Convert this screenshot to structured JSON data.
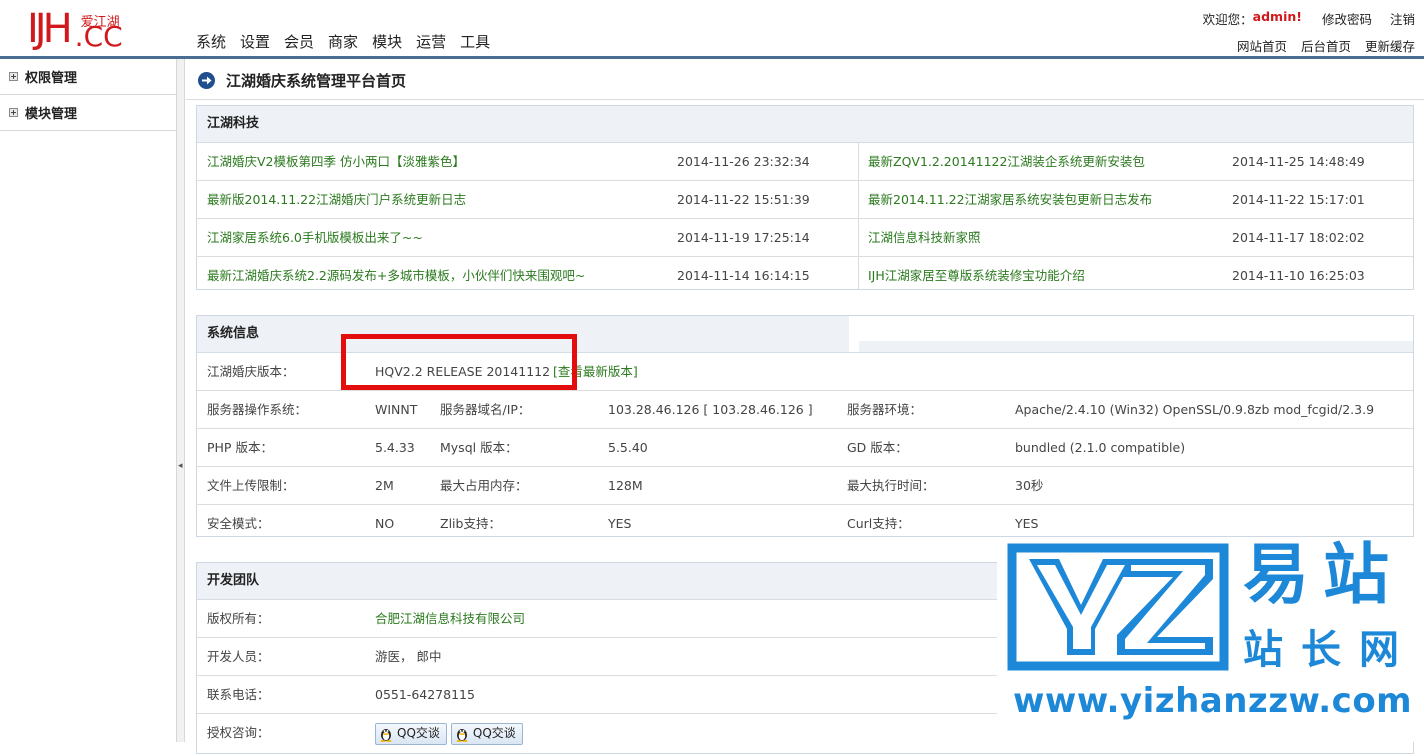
{
  "logo": {
    "ij": "IJH",
    "cn": "爱江湖",
    "cc": ".CC"
  },
  "nav": [
    "系统",
    "设置",
    "会员",
    "商家",
    "模块",
    "运营",
    "工具"
  ],
  "topbar": {
    "welcome": "欢迎您：",
    "user": "admin!",
    "change_password": "修改密码",
    "logout": "注销",
    "site_home": "网站首页",
    "admin_home": "后台首页",
    "refresh_cache": "更新缓存"
  },
  "sidebar": {
    "items": [
      {
        "label": "权限管理"
      },
      {
        "label": "模块管理"
      }
    ]
  },
  "page_title": "江湖婚庆系统管理平台首页",
  "news": {
    "title": "江湖科技",
    "rows": [
      {
        "left_title": "江湖婚庆V2模板第四季 仿小两口【淡雅紫色】",
        "left_time": "2014-11-26 23:32:34",
        "right_title": "最新ZQV1.2.20141122江湖装企系统更新安装包",
        "right_time": "2014-11-25 14:48:49"
      },
      {
        "left_title": "最新版2014.11.22江湖婚庆门户系统更新日志",
        "left_time": "2014-11-22 15:51:39",
        "right_title": "最新2014.11.22江湖家居系统安装包更新日志发布",
        "right_time": "2014-11-22 15:17:01"
      },
      {
        "left_title": "江湖家居系统6.0手机版模板出来了~~",
        "left_time": "2014-11-19 17:25:14",
        "right_title": "江湖信息科技新家照",
        "right_time": "2014-11-17 18:02:02"
      },
      {
        "left_title": "最新江湖婚庆系统2.2源码发布+多城市模板，小伙伴们快来围观吧~",
        "left_time": "2014-11-14 16:14:15",
        "right_title": "IJH江湖家居至尊版系统装修宝功能介绍",
        "right_time": "2014-11-10 16:25:03"
      }
    ]
  },
  "system": {
    "title": "系统信息",
    "version_label": "江湖婚庆版本：",
    "version_value": "HQV2.2 RELEASE 20141112",
    "version_link": "[查看最新版本]",
    "rows": [
      {
        "l1": "服务器操作系统：",
        "v1": "WINNT",
        "l2": "服务器域名/IP：",
        "v2": "103.28.46.126 [ 103.28.46.126 ]",
        "l3": "服务器环境：",
        "v3": "Apache/2.4.10 (Win32) OpenSSL/0.9.8zb mod_fcgid/2.3.9"
      },
      {
        "l1": "PHP 版本：",
        "v1": "5.4.33",
        "l2": "Mysql 版本：",
        "v2": "5.5.40",
        "l3": "GD 版本：",
        "v3": "bundled (2.1.0 compatible)"
      },
      {
        "l1": "文件上传限制：",
        "v1": "2M",
        "l2": "最大占用内存：",
        "v2": "128M",
        "l3": "最大执行时间：",
        "v3": "30秒"
      },
      {
        "l1": "安全模式：",
        "v1": "NO",
        "l2": "Zlib支持：",
        "v2": "YES",
        "l3": "Curl支持：",
        "v3": "YES"
      }
    ]
  },
  "team": {
    "title": "开发团队",
    "copyright_label": "版权所有：",
    "copyright_value": "合肥江湖信息科技有限公司",
    "dev_label": "开发人员：",
    "dev_value": "游医， 郎中",
    "phone_label": "联系电话：",
    "phone_value": "0551-64278115",
    "auth_label": "授权咨询：",
    "qq_buttons": [
      "QQ交谈",
      "QQ交谈"
    ]
  },
  "watermark": {
    "line1": "易站",
    "line2": "站长网",
    "url": "www.yizhanzzw.com"
  },
  "colors": {
    "brand_red": "#d0191c",
    "link_green": "#2b7a1e",
    "header_blue": "#4a6d92",
    "watermark_blue": "#1d87d8",
    "highlight_red": "#e30d0d"
  }
}
